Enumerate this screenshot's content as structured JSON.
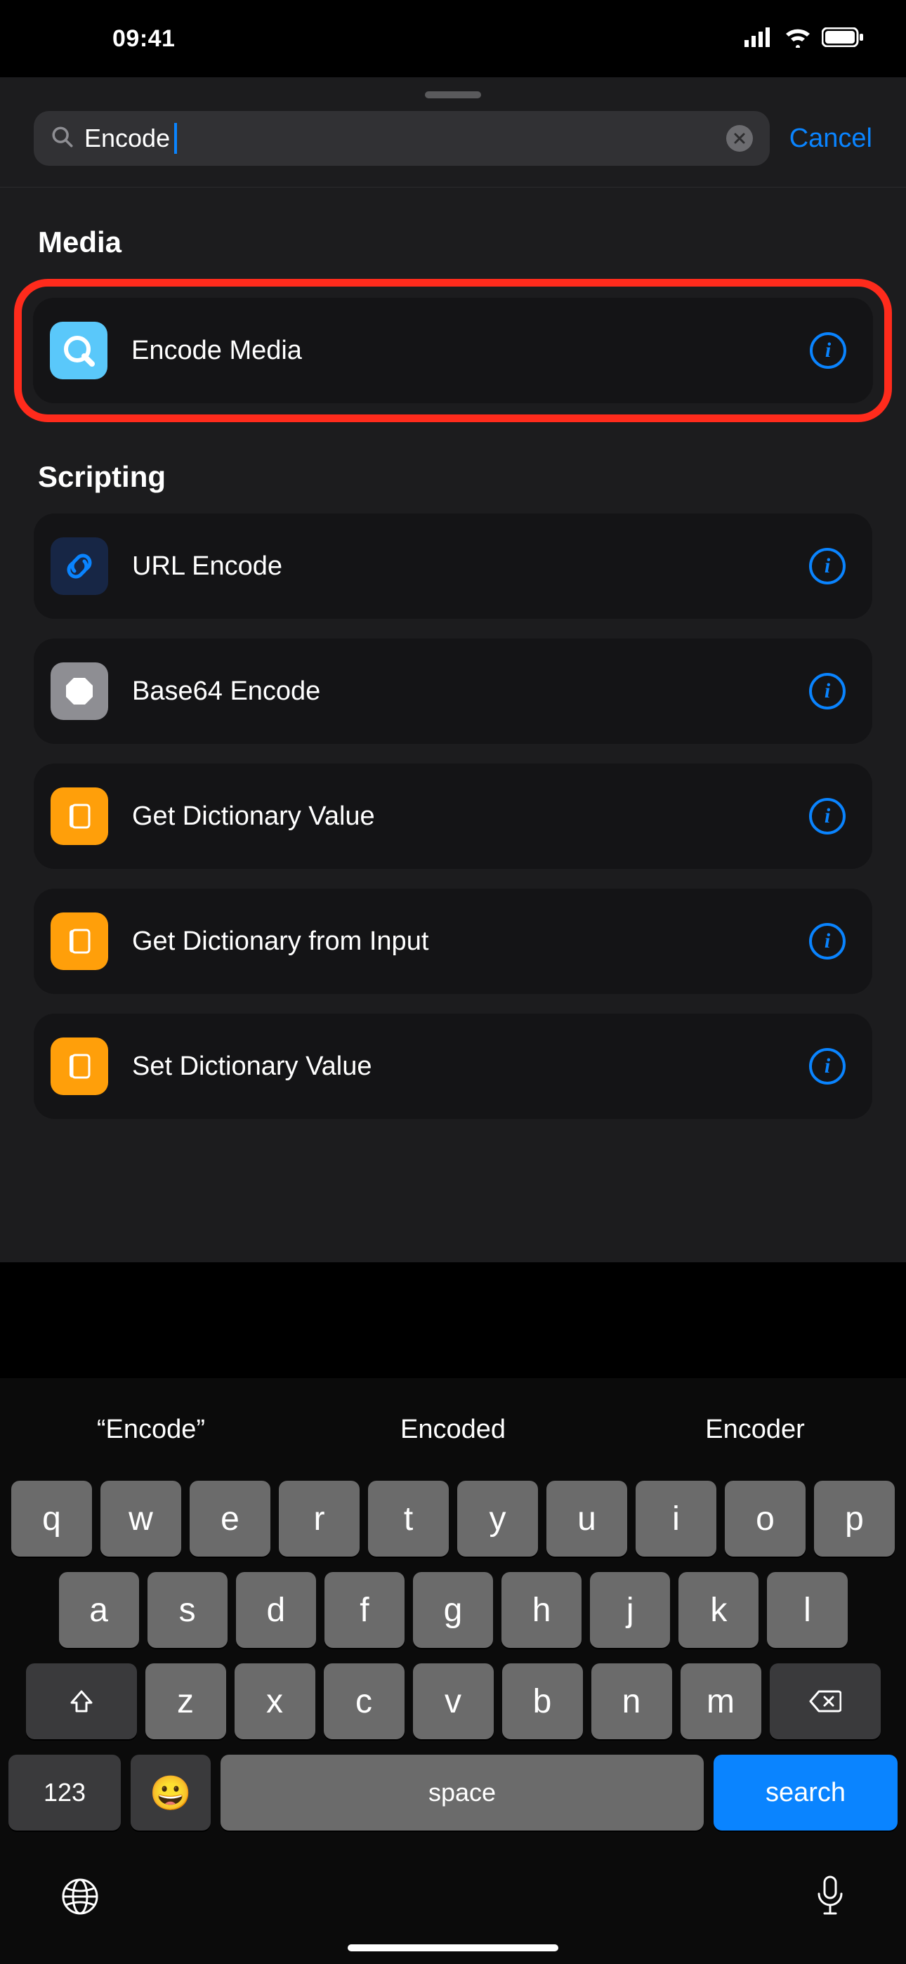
{
  "status": {
    "time": "09:41"
  },
  "search": {
    "query": "Encode",
    "placeholder": "",
    "cancel": "Cancel"
  },
  "sections": [
    {
      "title": "Media",
      "items": [
        {
          "icon": "quicktime-icon",
          "label": "Encode Media",
          "highlight": true
        }
      ]
    },
    {
      "title": "Scripting",
      "items": [
        {
          "icon": "link-icon",
          "label": "URL Encode"
        },
        {
          "icon": "dot-icon",
          "label": "Base64 Encode"
        },
        {
          "icon": "dict-icon",
          "label": "Get Dictionary Value"
        },
        {
          "icon": "dict-icon",
          "label": "Get Dictionary from Input"
        },
        {
          "icon": "dict-icon",
          "label": "Set Dictionary Value"
        }
      ]
    }
  ],
  "keyboard": {
    "suggestions": [
      "“Encode”",
      "Encoded",
      "Encoder"
    ],
    "row1": [
      "q",
      "w",
      "e",
      "r",
      "t",
      "y",
      "u",
      "i",
      "o",
      "p"
    ],
    "row2": [
      "a",
      "s",
      "d",
      "f",
      "g",
      "h",
      "j",
      "k",
      "l"
    ],
    "row3": [
      "z",
      "x",
      "c",
      "v",
      "b",
      "n",
      "m"
    ],
    "num": "123",
    "space": "space",
    "search": "search"
  }
}
